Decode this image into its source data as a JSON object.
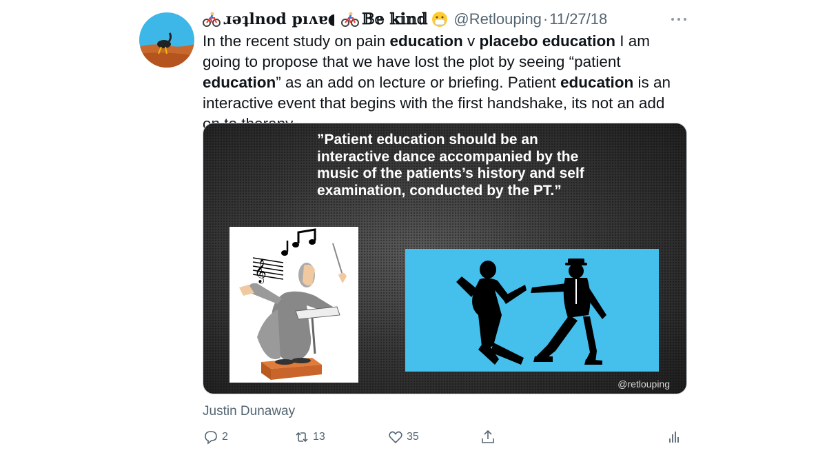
{
  "tweet": {
    "display_name": "𝔇𝔞𝔳𝔦𝔡 𝔭𝔬𝔲𝔩𝔱𝔢𝔯",
    "display_name_flipped": "ɹǝʇlnod pıʌɐ◖",
    "status": "𝔹𝕖 𝕜𝕚𝕟𝕕",
    "handle": "@Retlouping",
    "separator": "·",
    "date": "11/27/18",
    "text_parts": {
      "p1": "In the recent study on pain ",
      "b1": "education",
      "p2": " v ",
      "b2": "placebo education",
      "p3": " I am going to propose that we have lost the plot by seeing “patient ",
      "b3": "education",
      "p4": "” as an add on lecture or briefing. Patient ",
      "b4": "education",
      "p5": " is an interactive event that begins with the first handshake, its not an add on to therapy."
    }
  },
  "media": {
    "quote": "”Patient education should be an interactive dance accompanied by the music of the patients’s history and self examination, conducted by the PT.”",
    "credit": "@retlouping"
  },
  "attribution": "Justin Dunaway",
  "actions": {
    "reply_count": "2",
    "retweet_count": "13",
    "like_count": "35"
  },
  "icons": [
    "bicycle-icon",
    "mask-face-icon",
    "more-icon",
    "reply-icon",
    "retweet-icon",
    "like-icon",
    "share-icon",
    "analytics-icon"
  ]
}
